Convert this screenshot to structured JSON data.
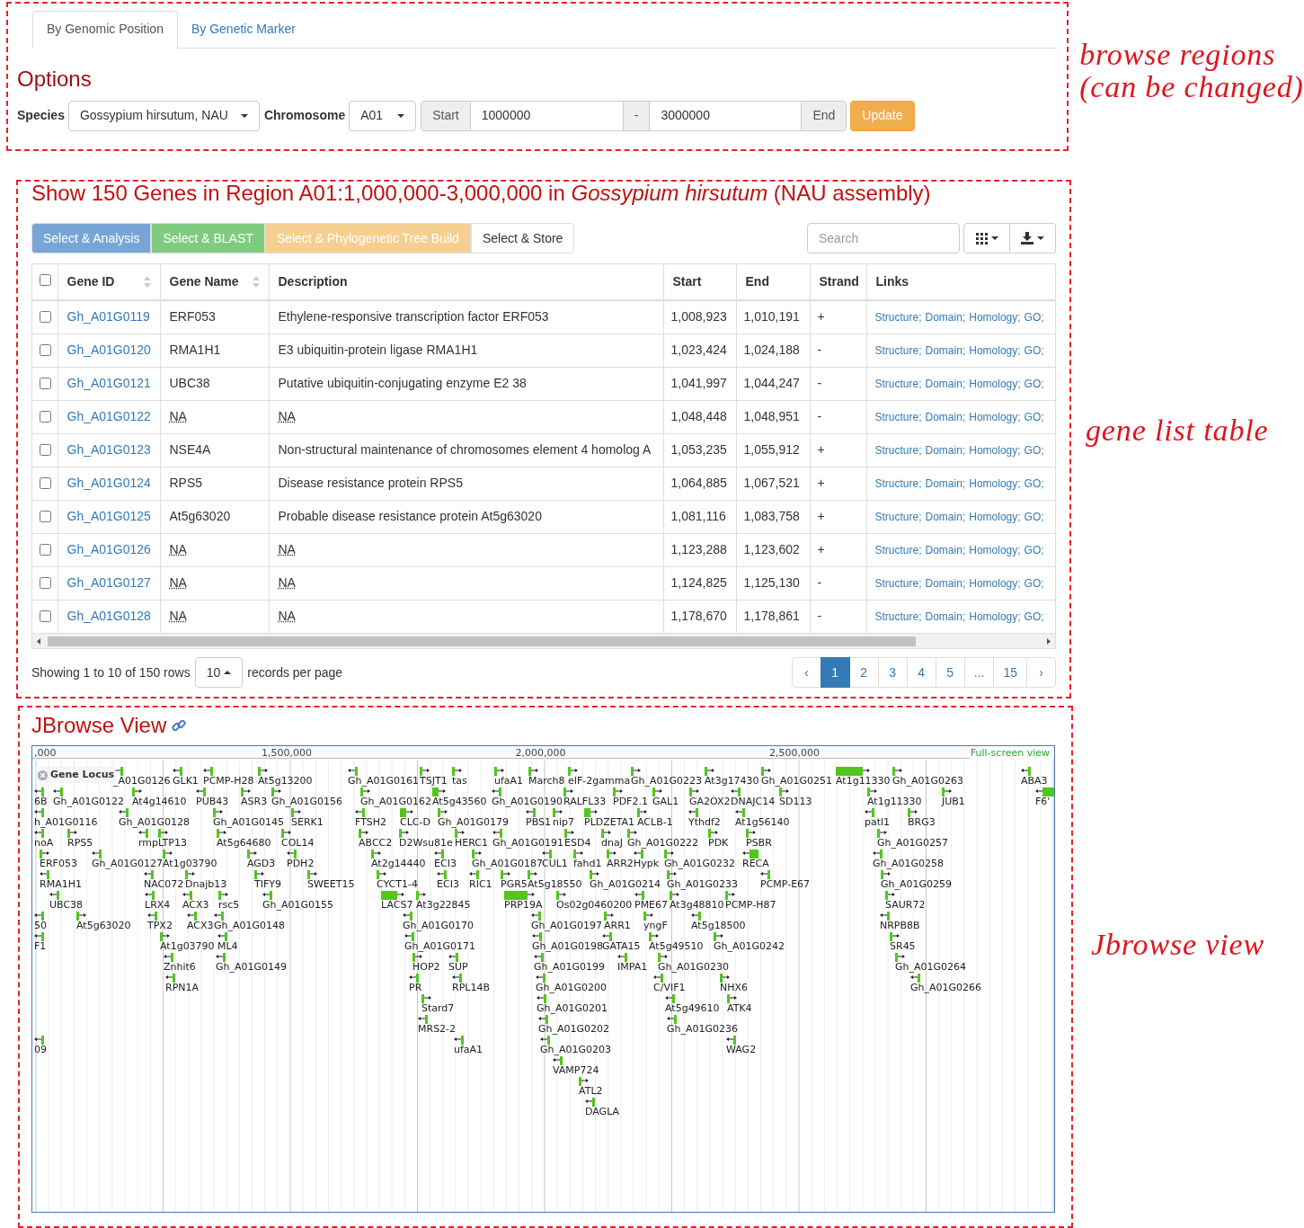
{
  "search_panel": {
    "tabs": [
      {
        "label": "By Genomic Position",
        "selected": true
      },
      {
        "label": "By Genetic Marker",
        "selected": false
      }
    ],
    "title": "Options",
    "species_label": "Species",
    "species": "Gossypium hirsutum, NAU",
    "chromosome_label": "Chromosome",
    "chromosome": "A01",
    "start_label": "Start",
    "start": "1000000",
    "separator": "-",
    "end": "3000000",
    "end_label": "End",
    "update_button": "Update"
  },
  "gene_list": {
    "title": "Show 150 Genes in Region A01:1,000,000-3,000,000 in *Gossypium hirsutum* (NAU assembly)",
    "actions": [
      {
        "label": "Select & Analysis",
        "color": "#77a6d6"
      },
      {
        "label": "Select & BLAST",
        "color": "#7fcb7f"
      },
      {
        "label": "Select & Phylogenetic Tree Build",
        "color": "#f6cf90"
      },
      {
        "label": "Select & Store",
        "color": "#ffffff"
      }
    ],
    "search": {
      "placeholder": "Search"
    },
    "select_all_checked": false,
    "columns": [
      {
        "label": "Gene ID",
        "sortable": true
      },
      {
        "label": "Gene Name",
        "sortable": true
      },
      {
        "label": "Description",
        "sortable": false
      },
      {
        "label": "Start",
        "sortable": false
      },
      {
        "label": "End",
        "sortable": false
      },
      {
        "label": "Strand",
        "sortable": false
      },
      {
        "label": "Links",
        "sortable": false
      }
    ],
    "rows": [
      {
        "checked": false,
        "gene_id": "Gh_A01G0119",
        "gene_name": "ERF053",
        "description": "Ethylene-responsive transcription factor ERF053",
        "na": false,
        "start": "1,008,923",
        "end": "1,010,191",
        "strand": "+",
        "links": [
          "Structure;",
          "Domain;",
          "Homology;",
          "GO;"
        ]
      },
      {
        "checked": false,
        "gene_id": "Gh_A01G0120",
        "gene_name": "RMA1H1",
        "description": "E3 ubiquitin-protein ligase RMA1H1",
        "na": false,
        "start": "1,023,424",
        "end": "1,024,188",
        "strand": "-",
        "links": [
          "Structure;",
          "Domain;",
          "Homology;",
          "GO;"
        ]
      },
      {
        "checked": false,
        "gene_id": "Gh_A01G0121",
        "gene_name": "UBC38",
        "description": "Putative ubiquitin-conjugating enzyme E2 38",
        "na": false,
        "start": "1,041,997",
        "end": "1,044,247",
        "strand": "-",
        "links": [
          "Structure;",
          "Domain;",
          "Homology;",
          "GO;"
        ]
      },
      {
        "checked": false,
        "gene_id": "Gh_A01G0122",
        "gene_name": "NA",
        "description": "NA",
        "na": true,
        "start": "1,048,448",
        "end": "1,048,951",
        "strand": "-",
        "links": [
          "Structure;",
          "Domain;",
          "Homology;",
          "GO;"
        ]
      },
      {
        "checked": false,
        "gene_id": "Gh_A01G0123",
        "gene_name": "NSE4A",
        "description": "Non-structural maintenance of chromosomes element 4 homolog A",
        "na": false,
        "start": "1,053,235",
        "end": "1,055,912",
        "strand": "+",
        "links": [
          "Structure;",
          "Domain;",
          "Homology;",
          "GO;"
        ]
      },
      {
        "checked": false,
        "gene_id": "Gh_A01G0124",
        "gene_name": "RPS5",
        "description": "Disease resistance protein RPS5",
        "na": false,
        "start": "1,064,885",
        "end": "1,067,521",
        "strand": "+",
        "links": [
          "Structure;",
          "Domain;",
          "Homology;",
          "GO;"
        ]
      },
      {
        "checked": false,
        "gene_id": "Gh_A01G0125",
        "gene_name": "At5g63020",
        "description": "Probable disease resistance protein At5g63020",
        "na": false,
        "start": "1,081,116",
        "end": "1,083,758",
        "strand": "+",
        "links": [
          "Structure;",
          "Domain;",
          "Homology;",
          "GO;"
        ]
      },
      {
        "checked": false,
        "gene_id": "Gh_A01G0126",
        "gene_name": "NA",
        "description": "NA",
        "na": true,
        "start": "1,123,288",
        "end": "1,123,602",
        "strand": "+",
        "links": [
          "Structure;",
          "Domain;",
          "Homology;",
          "GO;"
        ]
      },
      {
        "checked": false,
        "gene_id": "Gh_A01G0127",
        "gene_name": "NA",
        "description": "NA",
        "na": true,
        "start": "1,124,825",
        "end": "1,125,130",
        "strand": "-",
        "links": [
          "Structure;",
          "Domain;",
          "Homology;",
          "GO;"
        ]
      },
      {
        "checked": false,
        "gene_id": "Gh_A01G0128",
        "gene_name": "NA",
        "description": "NA",
        "na": true,
        "start": "1,178,670",
        "end": "1,178,861",
        "strand": "-",
        "links": [
          "Structure;",
          "Domain;",
          "Homology;",
          "GO;"
        ]
      }
    ],
    "showing": "Showing 1 to 10 of 150 rows",
    "page_size": "10",
    "page_size_suffix": "records per page",
    "pages": [
      {
        "label": "‹",
        "selected": false
      },
      {
        "label": "1",
        "selected": true
      },
      {
        "label": "2",
        "selected": false
      },
      {
        "label": "3",
        "selected": false
      },
      {
        "label": "4",
        "selected": false
      },
      {
        "label": "5",
        "selected": false
      },
      {
        "label": "...",
        "selected": false
      },
      {
        "label": "15",
        "selected": false
      },
      {
        "label": "›",
        "selected": false
      }
    ]
  },
  "jbrowse": {
    "title": "JBrowse View",
    "ruler": [
      ",000",
      "1,500,000",
      "2,000,000",
      "2,500,000"
    ],
    "full_screen": "Full-screen view",
    "track_label": "Gene Locus",
    "rows": [
      {
        "features": [
          {
            "label": "_A01G0126",
            "reverse": true
          },
          {
            "label": "GLK1",
            "reverse": true
          },
          {
            "label": "PCMP-H28",
            "reverse": true
          },
          {
            "label": "At5g13200",
            "reverse": false
          },
          {
            "label": "Gh_A01G0161",
            "reverse": true
          },
          {
            "label": "TSJT1",
            "reverse": false
          },
          {
            "label": "tas",
            "reverse": false
          },
          {
            "label": "ufaA1",
            "reverse": false
          },
          {
            "label": "March8",
            "reverse": false
          },
          {
            "label": "eIF-2gamma",
            "reverse": false
          },
          {
            "label": "Gh_A01G0223",
            "reverse": false
          },
          {
            "label": "At3g17430",
            "reverse": false
          },
          {
            "label": "Gh_A01G0251",
            "reverse": false
          },
          {
            "label": "At1g11330",
            "reverse": false
          },
          {
            "label": "Gh_A01G0263",
            "reverse": false
          },
          {
            "label": "ABA3",
            "reverse": true
          }
        ]
      },
      {
        "features": [
          {
            "label": "6B",
            "reverse": true
          },
          {
            "label": "Gh_A01G0122",
            "reverse": true
          },
          {
            "label": "At4g14610",
            "reverse": false
          },
          {
            "label": "PUB43",
            "reverse": true
          },
          {
            "label": "ASR3",
            "reverse": false
          },
          {
            "label": "Gh_A01G0156",
            "reverse": false
          },
          {
            "label": "Gh_A01G0162",
            "reverse": false
          },
          {
            "label": "At5g43560",
            "reverse": false
          },
          {
            "label": "Gh_A01G0190",
            "reverse": true
          },
          {
            "label": "RALFL33",
            "reverse": false
          },
          {
            "label": "PDF2.1",
            "reverse": false
          },
          {
            "label": "GAL1",
            "reverse": false
          },
          {
            "label": "GA2OX2",
            "reverse": false
          },
          {
            "label": "DNAJC14",
            "reverse": true
          },
          {
            "label": "SD113",
            "reverse": false
          },
          {
            "label": "At1g11330",
            "reverse": false
          },
          {
            "label": "JUB1",
            "reverse": false
          },
          {
            "label": "F6'",
            "reverse": true
          }
        ]
      },
      {
        "features": [
          {
            "label": "h_A01G0116",
            "reverse": true
          },
          {
            "label": "Gh_A01G0128",
            "reverse": true
          },
          {
            "label": "Gh_A01G0145",
            "reverse": false
          },
          {
            "label": "SERK1",
            "reverse": false
          },
          {
            "label": "FTSH2",
            "reverse": true
          },
          {
            "label": "CLC-D",
            "reverse": false
          },
          {
            "label": "Gh_A01G0179",
            "reverse": false
          },
          {
            "label": "PBS1",
            "reverse": true
          },
          {
            "label": "nip7",
            "reverse": false
          },
          {
            "label": "PLDZETA1",
            "reverse": false
          },
          {
            "label": "ACLB-1",
            "reverse": false
          },
          {
            "label": "Ythdf2",
            "reverse": true
          },
          {
            "label": "At1g56140",
            "reverse": true
          },
          {
            "label": "patl1",
            "reverse": true
          },
          {
            "label": "BRG3",
            "reverse": false
          }
        ]
      },
      {
        "features": [
          {
            "label": "noA",
            "reverse": true
          },
          {
            "label": "RPS5",
            "reverse": false
          },
          {
            "label": "rmp",
            "reverse": true
          },
          {
            "label": "LTP13",
            "reverse": false
          },
          {
            "label": "At5g64680",
            "reverse": false
          },
          {
            "label": "COL14",
            "reverse": false
          },
          {
            "label": "ABCC2",
            "reverse": false
          },
          {
            "label": "D2Wsu81e",
            "reverse": false
          },
          {
            "label": "HERC1",
            "reverse": false
          },
          {
            "label": "Gh_A01G0191",
            "reverse": true
          },
          {
            "label": "ESD4",
            "reverse": false
          },
          {
            "label": "dnaJ",
            "reverse": false
          },
          {
            "label": "Gh_A01G0222",
            "reverse": false
          },
          {
            "label": "PDK",
            "reverse": false
          },
          {
            "label": "PSBR",
            "reverse": false
          },
          {
            "label": "Gh_A01G0257",
            "reverse": false
          }
        ]
      },
      {
        "features": [
          {
            "label": "ERF053",
            "reverse": false
          },
          {
            "label": "Gh_A01G0127",
            "reverse": true
          },
          {
            "label": "At1g03790",
            "reverse": false
          },
          {
            "label": "AGD3",
            "reverse": false
          },
          {
            "label": "PDH2",
            "reverse": true
          },
          {
            "label": "At2g14440",
            "reverse": false
          },
          {
            "label": "ECI3",
            "reverse": true
          },
          {
            "label": "Gh_A01G0187",
            "reverse": false
          },
          {
            "label": "CUL1",
            "reverse": true
          },
          {
            "label": "fahd1",
            "reverse": false
          },
          {
            "label": "ARR2",
            "reverse": false
          },
          {
            "label": "Hypk",
            "reverse": true
          },
          {
            "label": "Gh_A01G0232",
            "reverse": false
          },
          {
            "label": "RECA",
            "reverse": true
          },
          {
            "label": "Gh_A01G0258",
            "reverse": true
          }
        ]
      },
      {
        "features": [
          {
            "label": "RMA1H1",
            "reverse": true
          },
          {
            "label": "NAC072",
            "reverse": true
          },
          {
            "label": "Dnajb13",
            "reverse": false
          },
          {
            "label": "TIFY9",
            "reverse": false
          },
          {
            "label": "SWEET15",
            "reverse": false
          },
          {
            "label": "CYCT1-4",
            "reverse": false
          },
          {
            "label": "ECI3",
            "reverse": true
          },
          {
            "label": "RIC1",
            "reverse": true
          },
          {
            "label": "PGR5",
            "reverse": false
          },
          {
            "label": "At5g18550",
            "reverse": false
          },
          {
            "label": "Gh_A01G0214",
            "reverse": false
          },
          {
            "label": "Gh_A01G0233",
            "reverse": false
          },
          {
            "label": "PCMP-E67",
            "reverse": true
          },
          {
            "label": "Gh_A01G0259",
            "reverse": false
          }
        ]
      },
      {
        "features": [
          {
            "label": "UBC38",
            "reverse": true
          },
          {
            "label": "LRX4",
            "reverse": true
          },
          {
            "label": "ACX3",
            "reverse": true
          },
          {
            "label": "rsc5",
            "reverse": false
          },
          {
            "label": "Gh_A01G0155",
            "reverse": true
          },
          {
            "label": "LACS7",
            "reverse": false
          },
          {
            "label": "At3g22845",
            "reverse": false
          },
          {
            "label": "PRP19A",
            "reverse": false
          },
          {
            "label": "Os02g0460200",
            "reverse": false
          },
          {
            "label": "PME67",
            "reverse": true
          },
          {
            "label": "At3g48810",
            "reverse": false
          },
          {
            "label": "PCMP-H87",
            "reverse": false
          },
          {
            "label": "SAUR72",
            "reverse": false
          }
        ]
      },
      {
        "features": [
          {
            "label": "50",
            "reverse": true
          },
          {
            "label": "At5g63020",
            "reverse": false
          },
          {
            "label": "TPX2",
            "reverse": true
          },
          {
            "label": "ACX3",
            "reverse": true
          },
          {
            "label": "Gh_A01G0148",
            "reverse": true
          },
          {
            "label": "Gh_A01G0170",
            "reverse": true
          },
          {
            "label": "Gh_A01G0197",
            "reverse": true
          },
          {
            "label": "ARR1",
            "reverse": false
          },
          {
            "label": "yngF",
            "reverse": false
          },
          {
            "label": "At5g18500",
            "reverse": true
          },
          {
            "label": "NRPB8B",
            "reverse": true
          }
        ]
      },
      {
        "features": [
          {
            "label": "F1",
            "reverse": true
          },
          {
            "label": "At1g03790",
            "reverse": false
          },
          {
            "label": "ML4",
            "reverse": true
          },
          {
            "label": "Gh_A01G0171",
            "reverse": true
          },
          {
            "label": "Gh_A01G0198",
            "reverse": true
          },
          {
            "label": "GATA15",
            "reverse": true
          },
          {
            "label": "At5g49510",
            "reverse": false
          },
          {
            "label": "Gh_A01G0242",
            "reverse": false
          },
          {
            "label": "SR45",
            "reverse": false
          }
        ]
      },
      {
        "features": [
          {
            "label": "Znhit6",
            "reverse": true
          },
          {
            "label": "Gh_A01G0149",
            "reverse": true
          },
          {
            "label": "HOP2",
            "reverse": false
          },
          {
            "label": "SUP",
            "reverse": true
          },
          {
            "label": "Gh_A01G0199",
            "reverse": true
          },
          {
            "label": "IMPA1",
            "reverse": true
          },
          {
            "label": "Gh_A01G0230",
            "reverse": false
          },
          {
            "label": "Gh_A01G0264",
            "reverse": false
          }
        ]
      },
      {
        "features": [
          {
            "label": "RPN1A",
            "reverse": true
          },
          {
            "label": "PR",
            "reverse": true
          },
          {
            "label": "RPL14B",
            "reverse": true
          },
          {
            "label": "Gh_A01G0200",
            "reverse": true
          },
          {
            "label": "C/VIF1",
            "reverse": true
          },
          {
            "label": "NHX6",
            "reverse": false
          },
          {
            "label": "Gh_A01G0266",
            "reverse": true
          }
        ]
      },
      {
        "features": [
          {
            "label": "Stard7",
            "reverse": false
          },
          {
            "label": "Gh_A01G0201",
            "reverse": true
          },
          {
            "label": "At5g49610",
            "reverse": true
          },
          {
            "label": "ATK4",
            "reverse": false
          }
        ]
      },
      {
        "features": [
          {
            "label": "MRS2-2",
            "reverse": true
          },
          {
            "label": "Gh_A01G0202",
            "reverse": true
          },
          {
            "label": "Gh_A01G0236",
            "reverse": true
          }
        ]
      },
      {
        "features": [
          {
            "label": "09",
            "reverse": true
          },
          {
            "label": "ufaA1",
            "reverse": true
          },
          {
            "label": "Gh_A01G0203",
            "reverse": true
          },
          {
            "label": "WAG2",
            "reverse": true
          }
        ]
      },
      {
        "features": [
          {
            "label": "VAMP724",
            "reverse": true
          }
        ]
      },
      {
        "features": [
          {
            "label": "ATL2",
            "reverse": false
          }
        ]
      },
      {
        "features": [
          {
            "label": "DAGLA",
            "reverse": true
          }
        ]
      }
    ]
  },
  "annotations": [
    {
      "text": "browse regions (can be changed)"
    },
    {
      "text": "gene list table"
    },
    {
      "text": "Jbrowse view"
    }
  ]
}
